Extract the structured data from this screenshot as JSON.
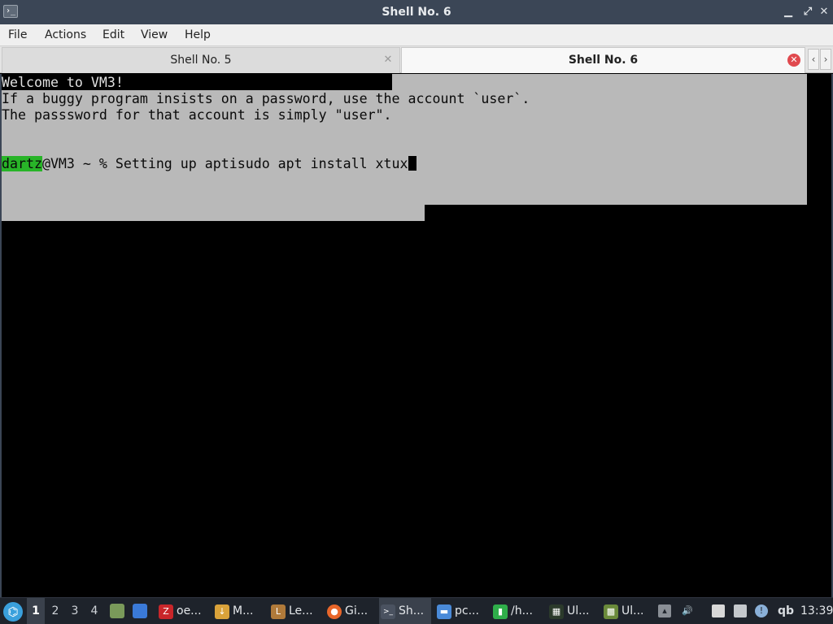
{
  "window": {
    "title": "Shell No. 6",
    "app_icon_glyph": "›_"
  },
  "controls": {
    "min": "▁",
    "max": "⤢",
    "close": "✕"
  },
  "menu": [
    {
      "label": "File"
    },
    {
      "label": "Actions"
    },
    {
      "label": "Edit"
    },
    {
      "label": "View"
    },
    {
      "label": "Help"
    }
  ],
  "tabs": [
    {
      "label": "Shell No. 5",
      "close": "✕"
    },
    {
      "label": "Shell No. 6",
      "close": "✕"
    }
  ],
  "tab_scroll": {
    "left": "‹",
    "right": "›"
  },
  "terminal": {
    "line1": "Welcome to VM3!",
    "line2": "If a buggy program insists on a password, use the account `user`.",
    "line3": "The passsword for that account is simply \"user\".",
    "prompt_user": "dartz",
    "prompt_rest": "@VM3 ~ % Setting up aptisudo apt install xtux"
  },
  "taskbar": {
    "workspaces": [
      "1",
      "2",
      "3",
      "4"
    ],
    "tasks": [
      {
        "label": "oe...",
        "icon": "filezilla-icon",
        "color": "#c8262a",
        "glyph": "Z"
      },
      {
        "label": "M...",
        "icon": "download-icon",
        "color": "#d9a23a",
        "glyph": "↓"
      },
      {
        "label": "Le...",
        "icon": "game-icon",
        "color": "#b07a3a",
        "glyph": "L"
      },
      {
        "label": "Gi...",
        "icon": "firefox-icon",
        "color": "#e8662a",
        "glyph": "●"
      },
      {
        "label": "Sh...",
        "icon": "terminal-icon",
        "color": "#4a5260",
        "glyph": ">_"
      },
      {
        "label": "pc...",
        "icon": "folder-icon",
        "color": "#4a8ad8",
        "glyph": "▬"
      },
      {
        "label": "/h...",
        "icon": "archive-icon",
        "color": "#2fae4a",
        "glyph": "▮"
      },
      {
        "label": "Ul...",
        "icon": "monitor-icon",
        "color": "#2b3a2b",
        "glyph": "▦"
      },
      {
        "label": "Ul...",
        "icon": "minecraft-icon",
        "color": "#6a8a3a",
        "glyph": "▩"
      }
    ],
    "clock": "13:39",
    "tray_text": "qb"
  }
}
